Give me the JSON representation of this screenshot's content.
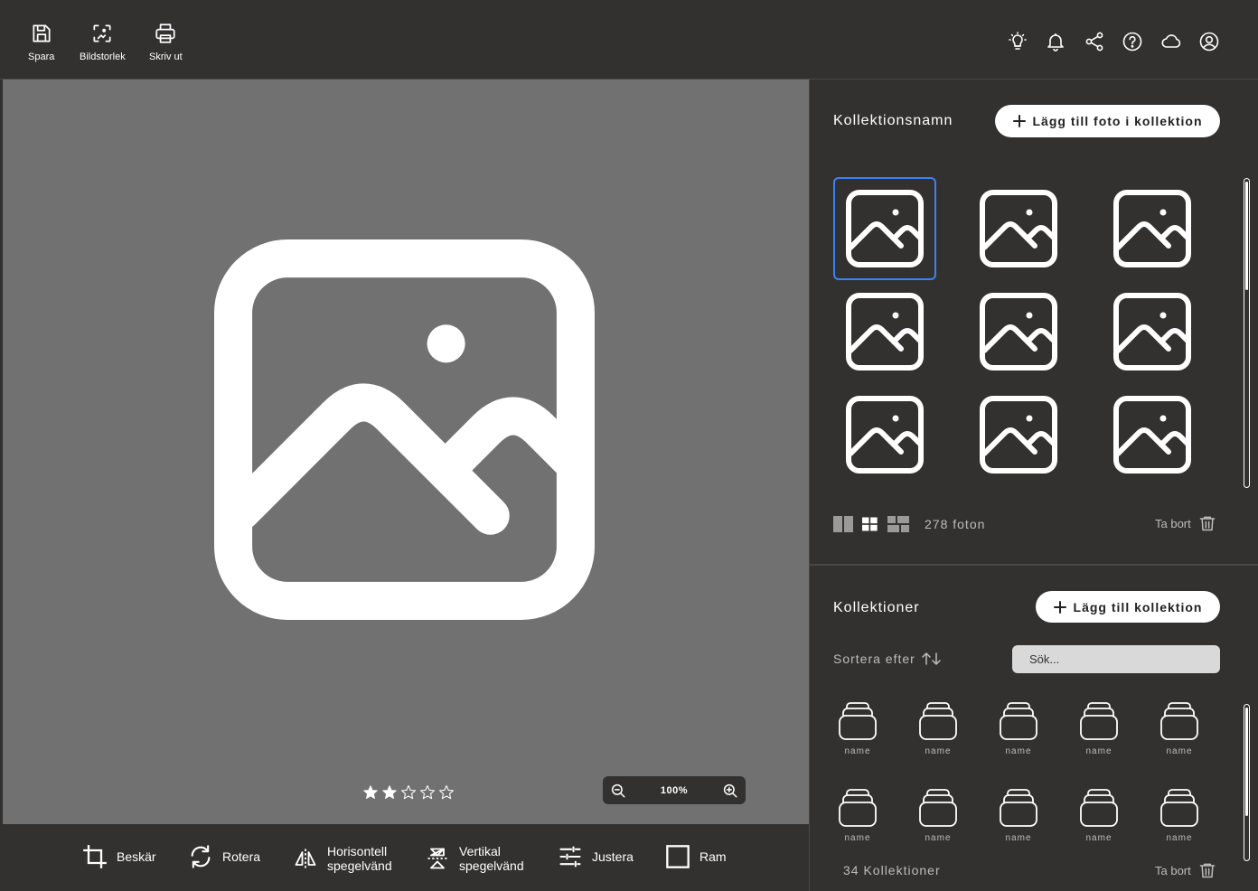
{
  "toolbar": {
    "save_label": "Spara",
    "size_label": "Bildstorlek",
    "print_label": "Skriv ut"
  },
  "topright_icons": [
    "lightbulb-icon",
    "bell-icon",
    "share-icon",
    "help-icon",
    "cloud-icon",
    "account-icon"
  ],
  "canvas": {
    "rating": 2,
    "rating_max": 5,
    "zoom_value": "100%"
  },
  "tools": {
    "crop": "Beskär",
    "rotate": "Rotera",
    "hflip_line1": "Horisontell",
    "hflip_line2": "spegelvänd",
    "vflip_line1": "Vertikal",
    "vflip_line2": "spegelvänd",
    "adjust": "Justera",
    "frame": "Ram"
  },
  "collection": {
    "title": "Kollektionsnamn",
    "add_button": "Lägg till foto i kollektion",
    "photo_count": "278 foton",
    "delete_label": "Ta bort",
    "selected_index": 0
  },
  "collections": {
    "title": "Kollektioner",
    "add_button": "Lägg till kollektion",
    "sort_label": "Sortera efter",
    "search_placeholder": "Sök...",
    "items": [
      "name",
      "name",
      "name",
      "name",
      "name",
      "name",
      "name",
      "name",
      "name",
      "name"
    ],
    "count_label": "34 Kollektioner",
    "delete_label": "Ta bort"
  },
  "colors": {
    "background": "#333030",
    "canvas": "#717171",
    "accent": "#3b82f6",
    "search_bg": "#d9d9d9"
  }
}
